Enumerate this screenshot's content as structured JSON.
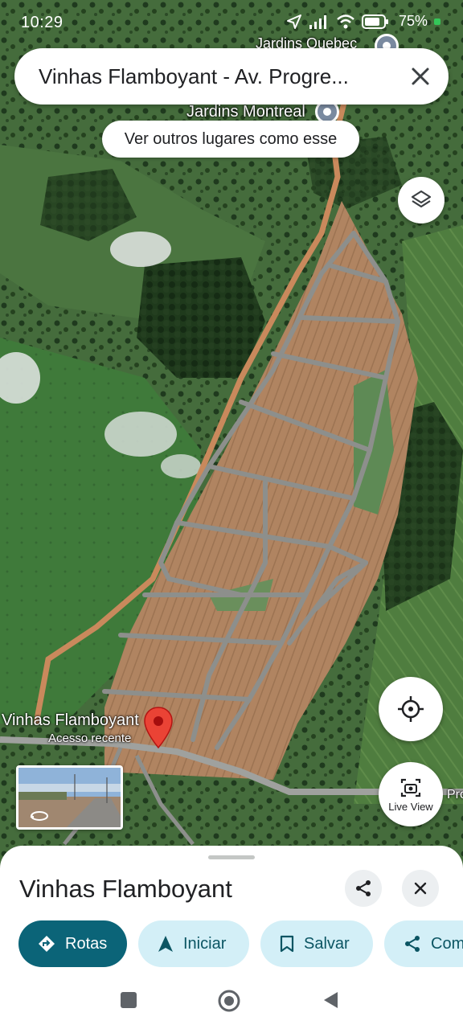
{
  "status_bar": {
    "time": "10:29",
    "battery": "75%"
  },
  "search": {
    "query": "Vinhas Flamboyant - Av. Progre..."
  },
  "map": {
    "label_quebec": "Jardins Quebec",
    "label_montreal": "Jardins Montreal",
    "similar_chip": "Ver outros lugares como esse",
    "place_name": "Vinhas Flamboyant",
    "place_sub": "Acesso recente",
    "road_label": "Progre",
    "live_view": "Live View"
  },
  "place_sheet": {
    "title": "Vinhas Flamboyant",
    "actions": [
      {
        "label": "Rotas",
        "icon": "directions-icon"
      },
      {
        "label": "Iniciar",
        "icon": "navigation-arrow-icon"
      },
      {
        "label": "Salvar",
        "icon": "bookmark-icon"
      },
      {
        "label": "Com",
        "icon": "share-icon"
      }
    ]
  },
  "colors": {
    "accent": "#0b6478",
    "chip_bg": "#d3eff7",
    "pin_red": "#ea4335"
  }
}
